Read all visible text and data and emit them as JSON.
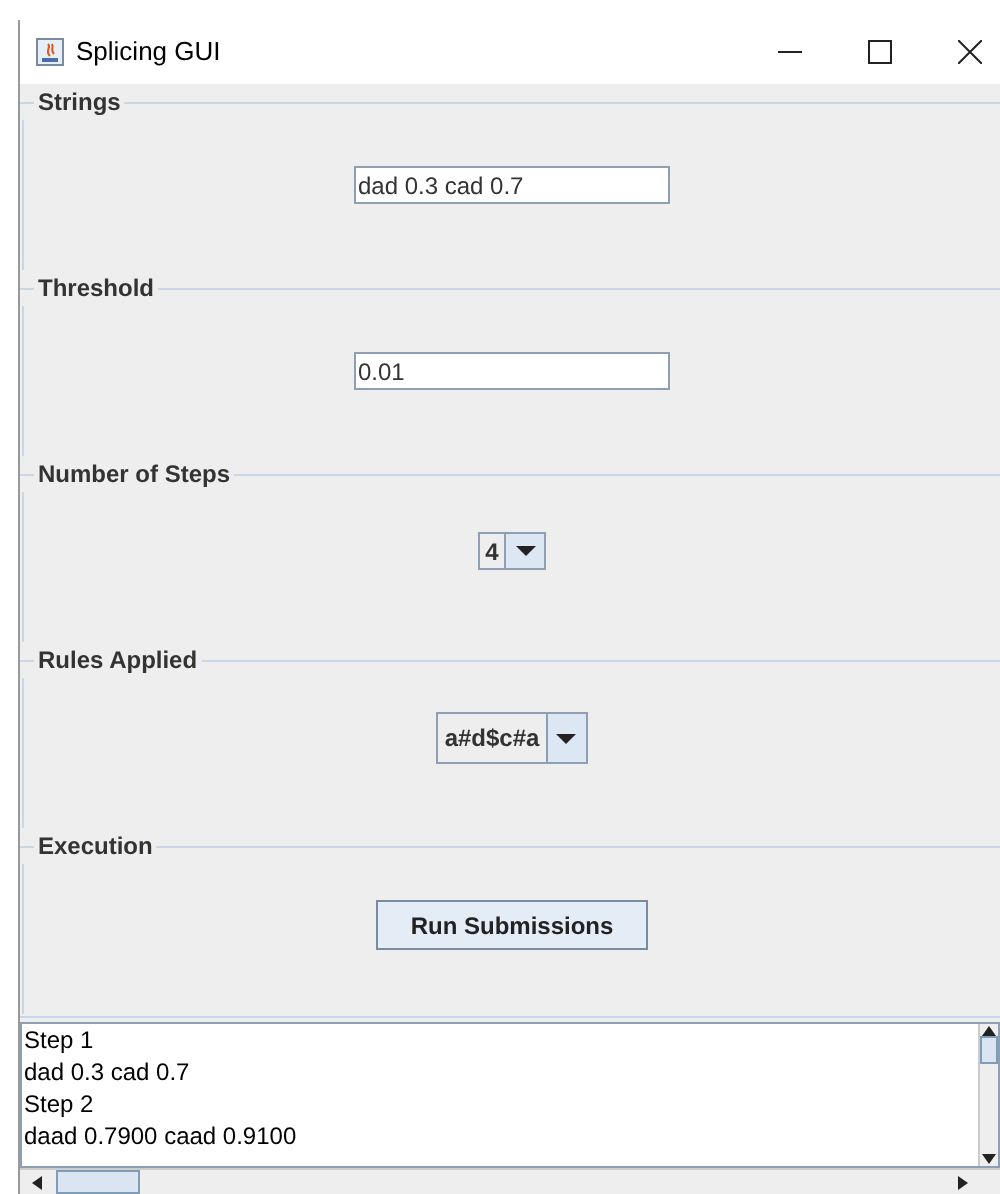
{
  "window": {
    "title": "Splicing GUI"
  },
  "sections": [
    {
      "kind": "text",
      "title": "Strings",
      "value": "dad 0.3 cad 0.7"
    },
    {
      "kind": "text",
      "title": "Threshold",
      "value": "0.01"
    },
    {
      "kind": "combo",
      "title": "Number of Steps",
      "value": "4"
    },
    {
      "kind": "combo",
      "title": "Rules Applied",
      "value": "a#d$c#a"
    },
    {
      "kind": "button",
      "title": "Execution",
      "value": "Run Submissions"
    }
  ],
  "output": {
    "lines": [
      "Step 1",
      "dad 0.3 cad 0.7",
      "Step 2",
      "daad 0.7900 caad 0.9100"
    ]
  }
}
